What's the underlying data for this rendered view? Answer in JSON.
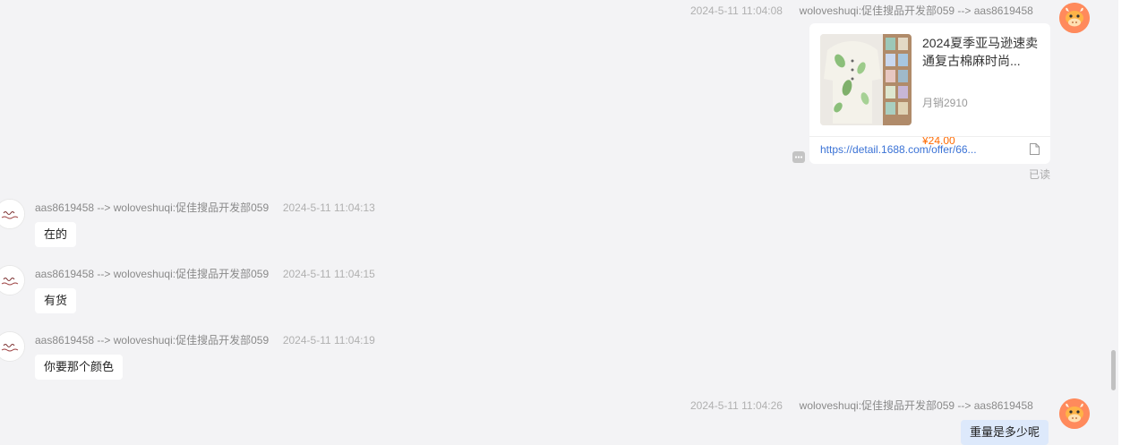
{
  "messages": [
    {
      "type": "product_card",
      "sender": "woloveshuqi:促佳搜品开发部059 --> aas8619458",
      "time": "2024-5-11 11:04:08",
      "product": {
        "title": "2024夏季亚马逊速卖通复古棉麻时尚...",
        "sales": "月销2910",
        "price": "¥24.00",
        "link": "https://detail.1688.com/offer/66..."
      },
      "status": "已读"
    },
    {
      "type": "text",
      "sender": "aas8619458 --> woloveshuqi:促佳搜品开发部059",
      "time": "2024-5-11 11:04:13",
      "text": "在的"
    },
    {
      "type": "text",
      "sender": "aas8619458 --> woloveshuqi:促佳搜品开发部059",
      "time": "2024-5-11 11:04:15",
      "text": "有货"
    },
    {
      "type": "text",
      "sender": "aas8619458 --> woloveshuqi:促佳搜品开发部059",
      "time": "2024-5-11 11:04:19",
      "text": "你要那个颜色"
    },
    {
      "type": "text",
      "sender": "woloveshuqi:促佳搜品开发部059 --> aas8619458",
      "time": "2024-5-11 11:04:26",
      "text": "重量是多少呢"
    }
  ],
  "colors": {
    "background": "#f3f3f5",
    "own_bubble": "#dde9fb",
    "other_bubble": "#ffffff",
    "price": "#ff6a00",
    "link": "#3b73d6",
    "avatar_cow": "#ff8a5c"
  },
  "icons": {
    "own_avatar": "cow-avatar-icon",
    "other_avatar": "shop-logo-avatar",
    "doc": "document-icon",
    "more": "more-options-icon"
  }
}
